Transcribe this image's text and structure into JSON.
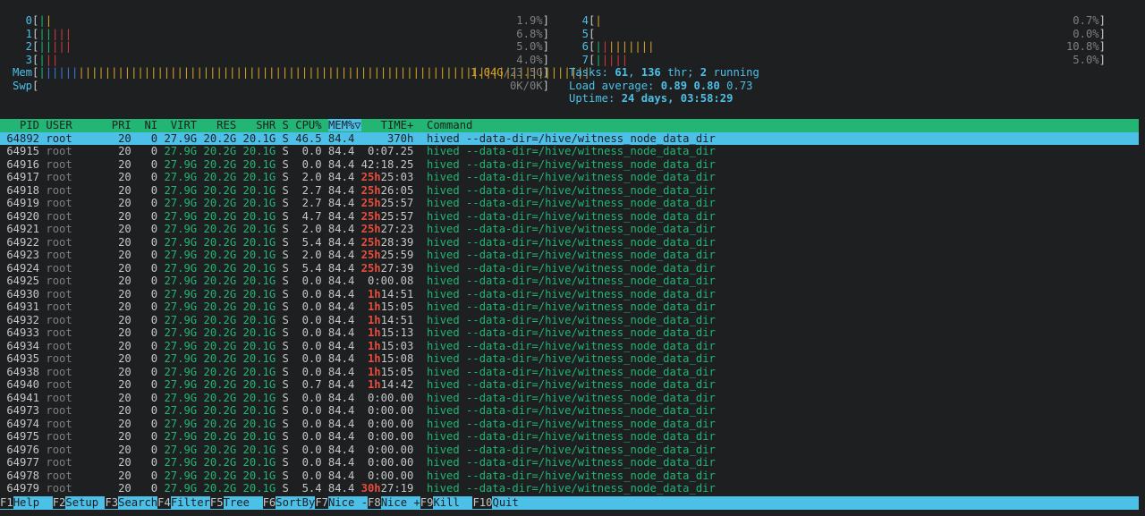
{
  "cpus_left": [
    {
      "id": "0",
      "bars": [
        [
          "g",
          "|"
        ],
        [
          "y",
          "|"
        ]
      ],
      "pct": "1.9%"
    },
    {
      "id": "1",
      "bars": [
        [
          "g",
          "|"
        ],
        [
          "g",
          "|"
        ],
        [
          "r",
          "|"
        ],
        [
          "r",
          "|"
        ],
        [
          "r",
          "|"
        ]
      ],
      "pct": "6.8%"
    },
    {
      "id": "2",
      "bars": [
        [
          "g",
          "|"
        ],
        [
          "g",
          "|"
        ],
        [
          "r",
          "|"
        ],
        [
          "r",
          "|"
        ],
        [
          "r",
          "|"
        ]
      ],
      "pct": "5.0%"
    },
    {
      "id": "3",
      "bars": [
        [
          "g",
          "|"
        ],
        [
          "r",
          "|"
        ],
        [
          "r",
          "|"
        ]
      ],
      "pct": "4.0%"
    }
  ],
  "cpus_right": [
    {
      "id": "4",
      "bars": [
        [
          "y",
          "|"
        ]
      ],
      "pct": "0.7%"
    },
    {
      "id": "5",
      "bars": [],
      "pct": "0.0%"
    },
    {
      "id": "6",
      "bars": [
        [
          "g",
          "|"
        ],
        [
          "r",
          "|"
        ],
        [
          "y",
          "|"
        ],
        [
          "y",
          "|"
        ],
        [
          "y",
          "|"
        ],
        [
          "y",
          "|"
        ],
        [
          "y",
          "|"
        ],
        [
          "y",
          "|"
        ],
        [
          "y",
          "|"
        ]
      ],
      "pct": "10.8%"
    },
    {
      "id": "7",
      "bars": [
        [
          "g",
          "|"
        ],
        [
          "r",
          "|"
        ],
        [
          "r",
          "|"
        ],
        [
          "r",
          "|"
        ],
        [
          "r",
          "|"
        ]
      ],
      "pct": "5.0%"
    }
  ],
  "mem": {
    "label": "Mem",
    "value": "1.04G",
    "total": "23.5G"
  },
  "swp": {
    "label": "Swp",
    "value": "0K",
    "total": "0K"
  },
  "tasks": {
    "label": "Tasks: ",
    "count": "61",
    "sep1": ", ",
    "thr": "136",
    "thr_label": " thr; ",
    "running": "2",
    "running_label": " running"
  },
  "load": {
    "label": "Load average: ",
    "one": "0.89",
    "five": "0.80",
    "fifteen": "0.73"
  },
  "uptime": {
    "label": "Uptime: ",
    "value": "24 days, 03:58:29"
  },
  "columns": [
    "PID",
    "USER",
    "PRI",
    "NI",
    "VIRT",
    "RES",
    "SHR",
    "S",
    "CPU%",
    "MEM%▽",
    "TIME+",
    "Command"
  ],
  "processes": [
    {
      "pid": "64892",
      "user": "root",
      "pri": "20",
      "ni": "0",
      "virt": "27.9G",
      "res": "20.2G",
      "shr": "20.1G",
      "s": "S",
      "cpu": "46.5",
      "mem": "84.4",
      "th": "",
      "tr": "   370h",
      "cmd": "hived --data-dir=/hive/witness_node_data_dir",
      "selected": true
    },
    {
      "pid": "64915",
      "user": "root",
      "pri": "20",
      "ni": "0",
      "virt": "27.9G",
      "res": "20.2G",
      "shr": "20.1G",
      "s": "S",
      "cpu": "0.0",
      "mem": "84.4",
      "th": "",
      "tr": "0:07.25",
      "cmd": "hived --data-dir=/hive/witness_node_data_dir"
    },
    {
      "pid": "64916",
      "user": "root",
      "pri": "20",
      "ni": "0",
      "virt": "27.9G",
      "res": "20.2G",
      "shr": "20.1G",
      "s": "S",
      "cpu": "0.0",
      "mem": "84.4",
      "th": "",
      "tr": "42:18.25",
      "cmd": "hived --data-dir=/hive/witness_node_data_dir"
    },
    {
      "pid": "64917",
      "user": "root",
      "pri": "20",
      "ni": "0",
      "virt": "27.9G",
      "res": "20.2G",
      "shr": "20.1G",
      "s": "S",
      "cpu": "2.0",
      "mem": "84.4",
      "th": "25h",
      "tr": "25:03",
      "cmd": "hived --data-dir=/hive/witness_node_data_dir"
    },
    {
      "pid": "64918",
      "user": "root",
      "pri": "20",
      "ni": "0",
      "virt": "27.9G",
      "res": "20.2G",
      "shr": "20.1G",
      "s": "S",
      "cpu": "2.7",
      "mem": "84.4",
      "th": "25h",
      "tr": "26:05",
      "cmd": "hived --data-dir=/hive/witness_node_data_dir"
    },
    {
      "pid": "64919",
      "user": "root",
      "pri": "20",
      "ni": "0",
      "virt": "27.9G",
      "res": "20.2G",
      "shr": "20.1G",
      "s": "S",
      "cpu": "2.7",
      "mem": "84.4",
      "th": "25h",
      "tr": "25:57",
      "cmd": "hived --data-dir=/hive/witness_node_data_dir"
    },
    {
      "pid": "64920",
      "user": "root",
      "pri": "20",
      "ni": "0",
      "virt": "27.9G",
      "res": "20.2G",
      "shr": "20.1G",
      "s": "S",
      "cpu": "4.7",
      "mem": "84.4",
      "th": "25h",
      "tr": "25:57",
      "cmd": "hived --data-dir=/hive/witness_node_data_dir"
    },
    {
      "pid": "64921",
      "user": "root",
      "pri": "20",
      "ni": "0",
      "virt": "27.9G",
      "res": "20.2G",
      "shr": "20.1G",
      "s": "S",
      "cpu": "2.0",
      "mem": "84.4",
      "th": "25h",
      "tr": "27:23",
      "cmd": "hived --data-dir=/hive/witness_node_data_dir"
    },
    {
      "pid": "64922",
      "user": "root",
      "pri": "20",
      "ni": "0",
      "virt": "27.9G",
      "res": "20.2G",
      "shr": "20.1G",
      "s": "S",
      "cpu": "5.4",
      "mem": "84.4",
      "th": "25h",
      "tr": "28:39",
      "cmd": "hived --data-dir=/hive/witness_node_data_dir"
    },
    {
      "pid": "64923",
      "user": "root",
      "pri": "20",
      "ni": "0",
      "virt": "27.9G",
      "res": "20.2G",
      "shr": "20.1G",
      "s": "S",
      "cpu": "2.0",
      "mem": "84.4",
      "th": "25h",
      "tr": "25:59",
      "cmd": "hived --data-dir=/hive/witness_node_data_dir"
    },
    {
      "pid": "64924",
      "user": "root",
      "pri": "20",
      "ni": "0",
      "virt": "27.9G",
      "res": "20.2G",
      "shr": "20.1G",
      "s": "S",
      "cpu": "5.4",
      "mem": "84.4",
      "th": "25h",
      "tr": "27:39",
      "cmd": "hived --data-dir=/hive/witness_node_data_dir"
    },
    {
      "pid": "64925",
      "user": "root",
      "pri": "20",
      "ni": "0",
      "virt": "27.9G",
      "res": "20.2G",
      "shr": "20.1G",
      "s": "S",
      "cpu": "0.0",
      "mem": "84.4",
      "th": "",
      "tr": "0:00.08",
      "cmd": "hived --data-dir=/hive/witness_node_data_dir"
    },
    {
      "pid": "64930",
      "user": "root",
      "pri": "20",
      "ni": "0",
      "virt": "27.9G",
      "res": "20.2G",
      "shr": "20.1G",
      "s": "S",
      "cpu": "0.0",
      "mem": "84.4",
      "th": "1h",
      "tr": "14:51",
      "cmd": "hived --data-dir=/hive/witness_node_data_dir"
    },
    {
      "pid": "64931",
      "user": "root",
      "pri": "20",
      "ni": "0",
      "virt": "27.9G",
      "res": "20.2G",
      "shr": "20.1G",
      "s": "S",
      "cpu": "0.0",
      "mem": "84.4",
      "th": "1h",
      "tr": "15:05",
      "cmd": "hived --data-dir=/hive/witness_node_data_dir"
    },
    {
      "pid": "64932",
      "user": "root",
      "pri": "20",
      "ni": "0",
      "virt": "27.9G",
      "res": "20.2G",
      "shr": "20.1G",
      "s": "S",
      "cpu": "0.0",
      "mem": "84.4",
      "th": "1h",
      "tr": "14:51",
      "cmd": "hived --data-dir=/hive/witness_node_data_dir"
    },
    {
      "pid": "64933",
      "user": "root",
      "pri": "20",
      "ni": "0",
      "virt": "27.9G",
      "res": "20.2G",
      "shr": "20.1G",
      "s": "S",
      "cpu": "0.0",
      "mem": "84.4",
      "th": "1h",
      "tr": "15:13",
      "cmd": "hived --data-dir=/hive/witness_node_data_dir"
    },
    {
      "pid": "64934",
      "user": "root",
      "pri": "20",
      "ni": "0",
      "virt": "27.9G",
      "res": "20.2G",
      "shr": "20.1G",
      "s": "S",
      "cpu": "0.0",
      "mem": "84.4",
      "th": "1h",
      "tr": "15:03",
      "cmd": "hived --data-dir=/hive/witness_node_data_dir"
    },
    {
      "pid": "64935",
      "user": "root",
      "pri": "20",
      "ni": "0",
      "virt": "27.9G",
      "res": "20.2G",
      "shr": "20.1G",
      "s": "S",
      "cpu": "0.0",
      "mem": "84.4",
      "th": "1h",
      "tr": "15:08",
      "cmd": "hived --data-dir=/hive/witness_node_data_dir"
    },
    {
      "pid": "64938",
      "user": "root",
      "pri": "20",
      "ni": "0",
      "virt": "27.9G",
      "res": "20.2G",
      "shr": "20.1G",
      "s": "S",
      "cpu": "0.0",
      "mem": "84.4",
      "th": "1h",
      "tr": "15:05",
      "cmd": "hived --data-dir=/hive/witness_node_data_dir"
    },
    {
      "pid": "64940",
      "user": "root",
      "pri": "20",
      "ni": "0",
      "virt": "27.9G",
      "res": "20.2G",
      "shr": "20.1G",
      "s": "S",
      "cpu": "0.7",
      "mem": "84.4",
      "th": "1h",
      "tr": "14:42",
      "cmd": "hived --data-dir=/hive/witness_node_data_dir"
    },
    {
      "pid": "64941",
      "user": "root",
      "pri": "20",
      "ni": "0",
      "virt": "27.9G",
      "res": "20.2G",
      "shr": "20.1G",
      "s": "S",
      "cpu": "0.0",
      "mem": "84.4",
      "th": "",
      "tr": "0:00.00",
      "cmd": "hived --data-dir=/hive/witness_node_data_dir"
    },
    {
      "pid": "64973",
      "user": "root",
      "pri": "20",
      "ni": "0",
      "virt": "27.9G",
      "res": "20.2G",
      "shr": "20.1G",
      "s": "S",
      "cpu": "0.0",
      "mem": "84.4",
      "th": "",
      "tr": "0:00.00",
      "cmd": "hived --data-dir=/hive/witness_node_data_dir"
    },
    {
      "pid": "64974",
      "user": "root",
      "pri": "20",
      "ni": "0",
      "virt": "27.9G",
      "res": "20.2G",
      "shr": "20.1G",
      "s": "S",
      "cpu": "0.0",
      "mem": "84.4",
      "th": "",
      "tr": "0:00.00",
      "cmd": "hived --data-dir=/hive/witness_node_data_dir"
    },
    {
      "pid": "64975",
      "user": "root",
      "pri": "20",
      "ni": "0",
      "virt": "27.9G",
      "res": "20.2G",
      "shr": "20.1G",
      "s": "S",
      "cpu": "0.0",
      "mem": "84.4",
      "th": "",
      "tr": "0:00.00",
      "cmd": "hived --data-dir=/hive/witness_node_data_dir"
    },
    {
      "pid": "64976",
      "user": "root",
      "pri": "20",
      "ni": "0",
      "virt": "27.9G",
      "res": "20.2G",
      "shr": "20.1G",
      "s": "S",
      "cpu": "0.0",
      "mem": "84.4",
      "th": "",
      "tr": "0:00.00",
      "cmd": "hived --data-dir=/hive/witness_node_data_dir"
    },
    {
      "pid": "64977",
      "user": "root",
      "pri": "20",
      "ni": "0",
      "virt": "27.9G",
      "res": "20.2G",
      "shr": "20.1G",
      "s": "S",
      "cpu": "0.0",
      "mem": "84.4",
      "th": "",
      "tr": "0:00.00",
      "cmd": "hived --data-dir=/hive/witness_node_data_dir"
    },
    {
      "pid": "64978",
      "user": "root",
      "pri": "20",
      "ni": "0",
      "virt": "27.9G",
      "res": "20.2G",
      "shr": "20.1G",
      "s": "S",
      "cpu": "0.0",
      "mem": "84.4",
      "th": "",
      "tr": "0:00.00",
      "cmd": "hived --data-dir=/hive/witness_node_data_dir"
    },
    {
      "pid": "64979",
      "user": "root",
      "pri": "20",
      "ni": "0",
      "virt": "27.9G",
      "res": "20.2G",
      "shr": "20.1G",
      "s": "S",
      "cpu": "5.4",
      "mem": "84.4",
      "th": "30h",
      "tr": "27:19",
      "cmd": "hived --data-dir=/hive/witness_node_data_dir"
    }
  ],
  "footer": [
    {
      "key": "F1",
      "label": "Help  "
    },
    {
      "key": "F2",
      "label": "Setup "
    },
    {
      "key": "F3",
      "label": "Search"
    },
    {
      "key": "F4",
      "label": "Filter"
    },
    {
      "key": "F5",
      "label": "Tree  "
    },
    {
      "key": "F6",
      "label": "SortBy"
    },
    {
      "key": "F7",
      "label": "Nice -"
    },
    {
      "key": "F8",
      "label": "Nice +"
    },
    {
      "key": "F9",
      "label": "Kill  "
    },
    {
      "key": "F10",
      "label": "Quit"
    }
  ],
  "colors": {
    "green": "#22b573",
    "cyan": "#4dc0e8",
    "red": "#d03b3b",
    "yellow": "#d8a326",
    "background": "#1d1f21"
  }
}
